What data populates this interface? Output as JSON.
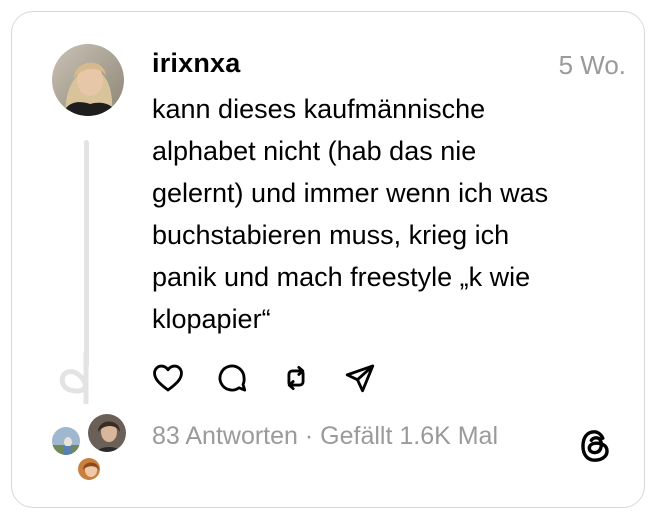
{
  "post": {
    "username": "irixnxa",
    "timestamp": "5 Wo.",
    "text": "kann dieses kaufmännische\nalphabet nicht (hab das nie\ngelernt) und immer wenn ich was\nbuchstabieren muss, krieg ich\npanik und mach freestyle „k wie\nklopapier“"
  },
  "actions": [
    {
      "icon": "heart-icon"
    },
    {
      "icon": "comment-icon"
    },
    {
      "icon": "repost-icon"
    },
    {
      "icon": "share-icon"
    }
  ],
  "footer": {
    "stats": "83 Antworten · Gefällt 1.6K Mal",
    "logo": "threads-logo-icon"
  },
  "colors": {
    "border": "#d8d8d8",
    "muted_text": "#9a9a9a",
    "thread_line": "#e3e3e3"
  }
}
